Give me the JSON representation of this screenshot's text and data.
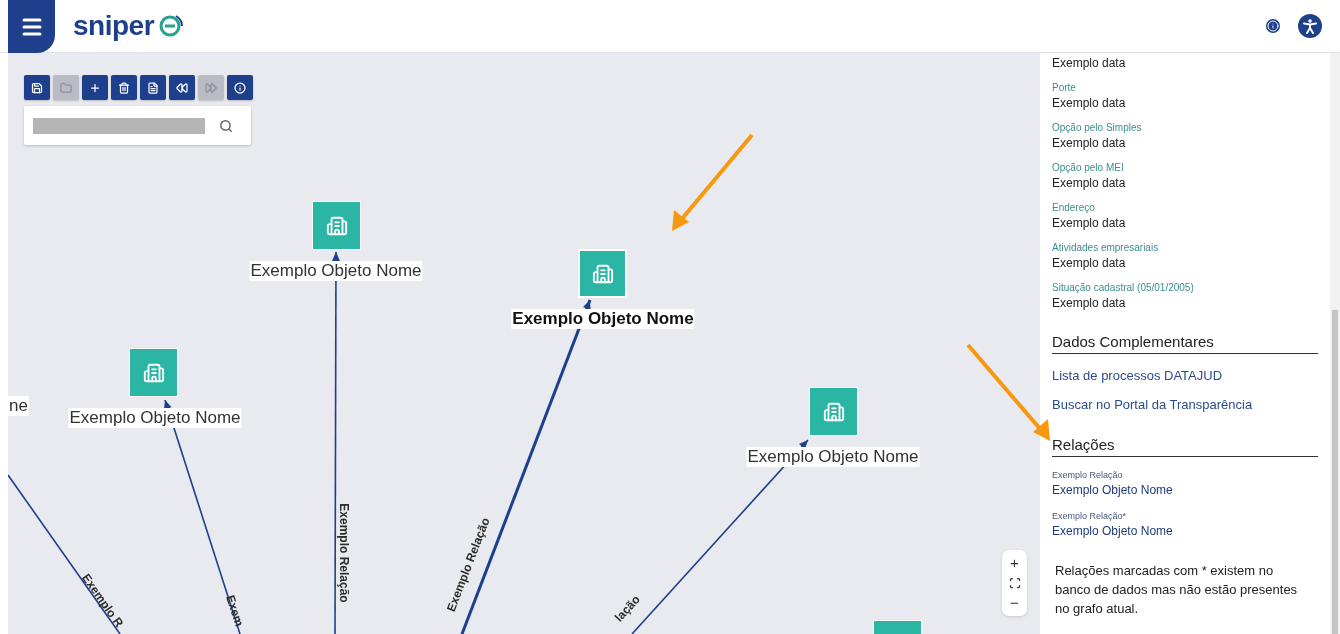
{
  "header": {
    "logo": "sniper"
  },
  "toolbar": {
    "buttons": [
      {
        "kind": "save",
        "disabled": false
      },
      {
        "kind": "open",
        "disabled": true
      },
      {
        "kind": "add",
        "disabled": false
      },
      {
        "kind": "delete",
        "disabled": false
      },
      {
        "kind": "export",
        "disabled": false
      },
      {
        "kind": "undo",
        "disabled": false
      },
      {
        "kind": "redo",
        "disabled": true
      },
      {
        "kind": "info",
        "disabled": false
      }
    ]
  },
  "graph": {
    "nodes": [
      {
        "label": "Exemplo Objeto Nome",
        "selected": false
      },
      {
        "label": "Exemplo Objeto Nome",
        "selected": true
      },
      {
        "label": "Exemplo Objeto Nome",
        "selected": false
      },
      {
        "label": "Exemplo Objeto Nome",
        "selected": false
      },
      {
        "label": "ne",
        "selected": false
      },
      {
        "selected": false
      }
    ],
    "edges": [
      {
        "label": "Exemplo Relação",
        "selected": false
      },
      {
        "label": "Exemplo Relação",
        "selected": true
      },
      {
        "label": "Exem",
        "selected": false
      },
      {
        "label": "lação",
        "selected": false
      },
      {
        "label": "Exemplo R",
        "selected": false
      }
    ],
    "zoom": {
      "zoom_in": "+",
      "zoom_out": "−"
    }
  },
  "sidebar": {
    "fields": [
      {
        "value": "Exemplo data"
      },
      {
        "label": "Porte",
        "value": "Exemplo data"
      },
      {
        "label": "Opção pelo Simples",
        "value": "Exemplo data"
      },
      {
        "label": "Opção pelo MEI",
        "value": "Exemplo data"
      },
      {
        "label": "Endereço",
        "value": "Exemplo data"
      },
      {
        "label": "Atividades empresariais",
        "value": "Exemplo data"
      },
      {
        "label": "Situação cadastral (05/01/2005)",
        "value": "Exemplo data"
      }
    ],
    "complementary": {
      "title": "Dados Complementares",
      "links": [
        "Lista de processos DATAJUD",
        "Buscar no Portal da Transparência"
      ]
    },
    "relations": {
      "title": "Relações",
      "items": [
        {
          "type": "Exemplo Relação",
          "target": "Exemplo Objeto Nome"
        },
        {
          "type": "Exemplo Relação*",
          "target": "Exemplo Objeto Nome"
        }
      ]
    },
    "note": "Relações marcadas com * existem no banco de dados mas não estão presentes no grafo atual."
  }
}
